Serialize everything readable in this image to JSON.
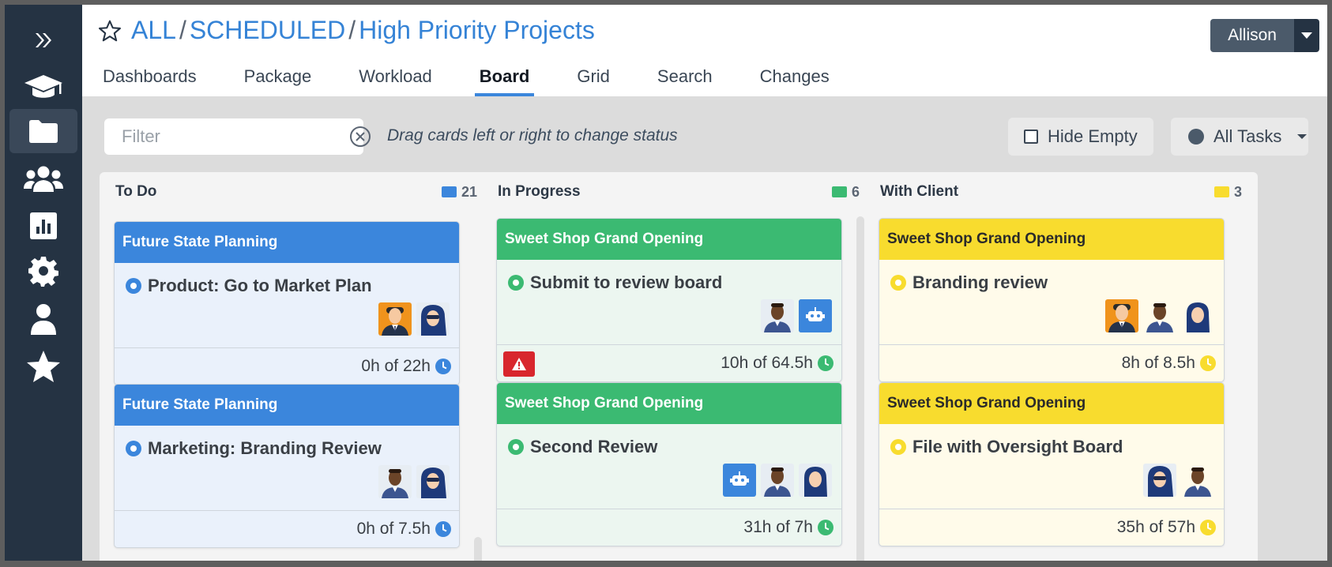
{
  "breadcrumb": {
    "all": "ALL",
    "scheduled": "SCHEDULED",
    "current": "High Priority Projects",
    "sep": "/"
  },
  "tabs": [
    {
      "label": "Dashboards"
    },
    {
      "label": "Package"
    },
    {
      "label": "Workload"
    },
    {
      "label": "Board",
      "active": true
    },
    {
      "label": "Grid"
    },
    {
      "label": "Search"
    },
    {
      "label": "Changes"
    }
  ],
  "user": {
    "name": "Allison"
  },
  "toolbar": {
    "filter_placeholder": "Filter",
    "hint": "Drag cards left or right to change status",
    "hide_empty": "Hide Empty",
    "all_tasks": "All Tasks"
  },
  "sidebar": [
    {
      "icon": "expand-icon"
    },
    {
      "icon": "graduation-cap-icon"
    },
    {
      "icon": "folder-icon",
      "active": true
    },
    {
      "icon": "users-icon"
    },
    {
      "icon": "chart-icon"
    },
    {
      "icon": "gear-icon"
    },
    {
      "icon": "user-icon"
    },
    {
      "icon": "star-icon"
    }
  ],
  "colors": {
    "blue": "#3b86dc",
    "green": "#3bba72",
    "yellow": "#f8dc2e",
    "warning": "#d8262d",
    "sidebar": "#253343"
  },
  "columns": [
    {
      "title": "To Do",
      "count": "21",
      "color": "blue",
      "cards": [
        {
          "project": "Future State Planning",
          "task": "Product: Go to Market Plan",
          "hours": "0h of 22h"
        },
        {
          "project": "Future State Planning",
          "task": "Marketing: Branding Review",
          "hours": "0h of 7.5h"
        }
      ]
    },
    {
      "title": "In Progress",
      "count": "6",
      "color": "green",
      "cards": [
        {
          "project": "Sweet Shop Grand Opening",
          "task": "Submit to review board",
          "hours": "10h of 64.5h",
          "warning": true
        },
        {
          "project": "Sweet Shop Grand Opening",
          "task": "Second Review",
          "hours": "31h of 7h"
        }
      ]
    },
    {
      "title": "With Client",
      "count": "3",
      "color": "yellow",
      "cards": [
        {
          "project": "Sweet Shop Grand Opening",
          "task": "Branding review",
          "hours": "8h of 8.5h"
        },
        {
          "project": "Sweet Shop Grand Opening",
          "task": "File with Oversight Board",
          "hours": "35h of 57h"
        }
      ]
    }
  ]
}
